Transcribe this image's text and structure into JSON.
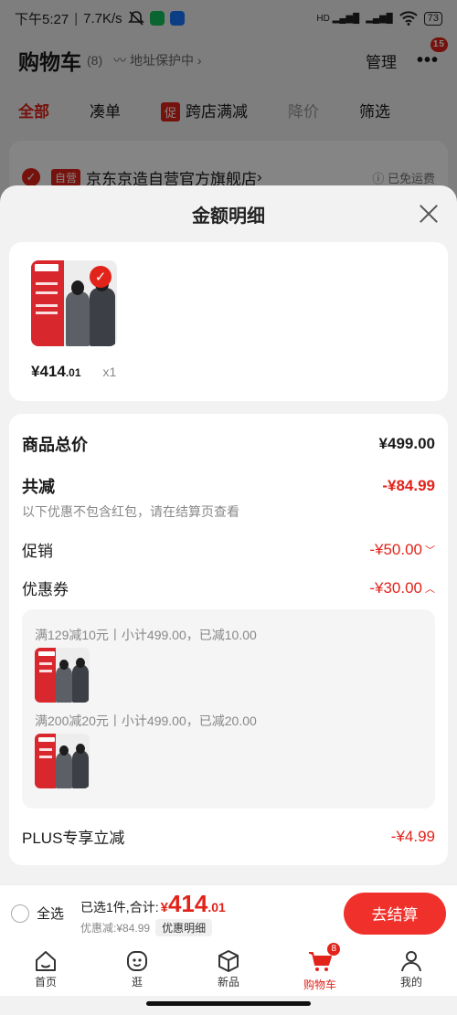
{
  "status_bar": {
    "time": "下午5:27",
    "speed": "7.7K/s",
    "battery": "73"
  },
  "cart_header": {
    "title": "购物车",
    "count": "(8)",
    "address_protect": "地址保护中",
    "manage": "管理",
    "more_badge": "15"
  },
  "tabs": [
    {
      "label": "全部"
    },
    {
      "label": "凑单"
    },
    {
      "tag": "促",
      "label": "跨店满减"
    },
    {
      "label": "降价"
    },
    {
      "label": "筛选"
    }
  ],
  "shop": {
    "tag": "自营",
    "name": "京东京造自营官方旗舰店",
    "shipping": "已免运费"
  },
  "sheet": {
    "title": "金额明细"
  },
  "product": {
    "price_symbol": "¥",
    "price_int": "414",
    "price_dec": ".01",
    "quantity": "x1"
  },
  "details": {
    "total_label": "商品总价",
    "total_value": "¥499.00",
    "reduce_label": "共减",
    "reduce_value": "-¥84.99",
    "note": "以下优惠不包含红包，请在结算页查看",
    "promo_label": "促销",
    "promo_value": "-¥50.00",
    "coupon_label": "优惠券",
    "coupon_value": "-¥30.00",
    "coupons": [
      {
        "text": "满129减10元丨小计499.00，已减10.00"
      },
      {
        "text": "满200减20元丨小计499.00，已减20.00"
      }
    ],
    "plus_label": "PLUS专享立减",
    "plus_value": "-¥4.99"
  },
  "checkout": {
    "select_all": "全选",
    "selected_text": "已选1件,合计:",
    "sum_symbol": "¥",
    "sum_int": "414",
    "sum_dec": ".01",
    "discount_text": "优惠减:¥84.99",
    "detail_chip": "优惠明细",
    "button": "去结算"
  },
  "navbar": [
    {
      "label": "首页",
      "icon": "home-icon"
    },
    {
      "label": "逛",
      "icon": "browse-icon"
    },
    {
      "label": "新品",
      "icon": "box-icon"
    },
    {
      "label": "购物车",
      "icon": "cart-icon",
      "badge": "8"
    },
    {
      "label": "我的",
      "icon": "user-icon"
    }
  ],
  "colors": {
    "accent": "#e2231a",
    "button": "#f0302a"
  }
}
